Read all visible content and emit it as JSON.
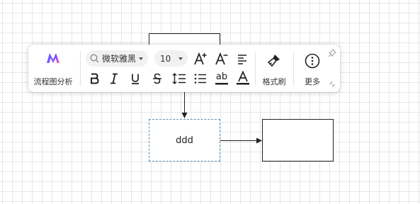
{
  "canvas": {
    "nodes": [
      {
        "id": "top",
        "text": ""
      },
      {
        "id": "mid",
        "text": "ddd",
        "selected": true
      },
      {
        "id": "right",
        "text": ""
      }
    ],
    "grid_color": "#e6e6e6",
    "selection_color": "#5b8fb8"
  },
  "toolbar": {
    "flow_analysis_label": "流程图分析",
    "font_family": "微软雅黑",
    "font_size": "10",
    "format_painter_label": "格式刷",
    "more_label": "更多",
    "icons": {
      "font_search": "search-icon",
      "increase_font": "increase-font-icon",
      "decrease_font": "decrease-font-icon",
      "align": "align-left-icon",
      "bold": "bold-icon",
      "italic": "italic-icon",
      "underline": "underline-icon",
      "strike": "strikethrough-icon",
      "line_spacing": "line-spacing-icon",
      "bullets": "bullet-list-icon",
      "text_bg": "text-background-icon",
      "font_color": "font-color-icon",
      "brush": "brush-icon",
      "more": "more-icon",
      "pin": "pin-icon",
      "collapse": "collapse-icon"
    }
  }
}
